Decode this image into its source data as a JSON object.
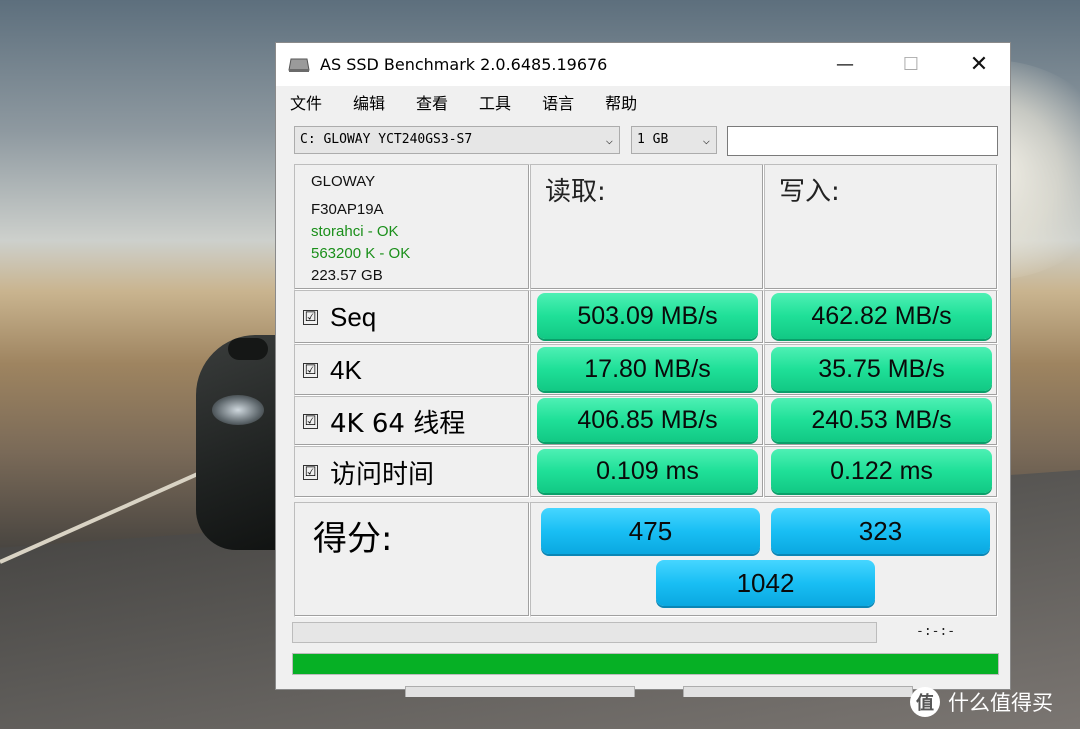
{
  "window": {
    "title": "AS SSD Benchmark 2.0.6485.19676",
    "controls": {
      "minimize": "—",
      "maximize": "☐",
      "close": "✕"
    }
  },
  "menu": [
    "文件",
    "编辑",
    "查看",
    "工具",
    "语言",
    "帮助"
  ],
  "drive_select": {
    "value": "C: GLOWAY YCT240GS3-S7"
  },
  "size_select": {
    "value": "1 GB"
  },
  "text_field": {
    "value": ""
  },
  "drive_info": {
    "vendor": "GLOWAY",
    "firmware": "F30AP19A",
    "driver_status": "storahci - OK",
    "alignment_status": "563200 K - OK",
    "capacity": "223.57 GB",
    "ok_color": "#1a8f1a"
  },
  "headers": {
    "read": "读取:",
    "write": "写入:"
  },
  "tests": [
    {
      "name": "Seq",
      "checked": "☑",
      "read": "503.09 MB/s",
      "write": "462.82 MB/s"
    },
    {
      "name": "4K",
      "checked": "☑",
      "read": "17.80 MB/s",
      "write": "35.75 MB/s"
    },
    {
      "name": "4K 64 线程",
      "checked": "☑",
      "read": "406.85 MB/s",
      "write": "240.53 MB/s"
    },
    {
      "name": "访问时间",
      "checked": "☑",
      "read": "0.109 ms",
      "write": "0.122 ms"
    }
  ],
  "score": {
    "label": "得分:",
    "read": "475",
    "write": "323",
    "total": "1042"
  },
  "progress": {
    "elapsed": "-:-:-",
    "overall_fraction": 1.0,
    "bar_color": "#06b025"
  },
  "watermark": {
    "logo": "值",
    "text": "什么值得买"
  }
}
